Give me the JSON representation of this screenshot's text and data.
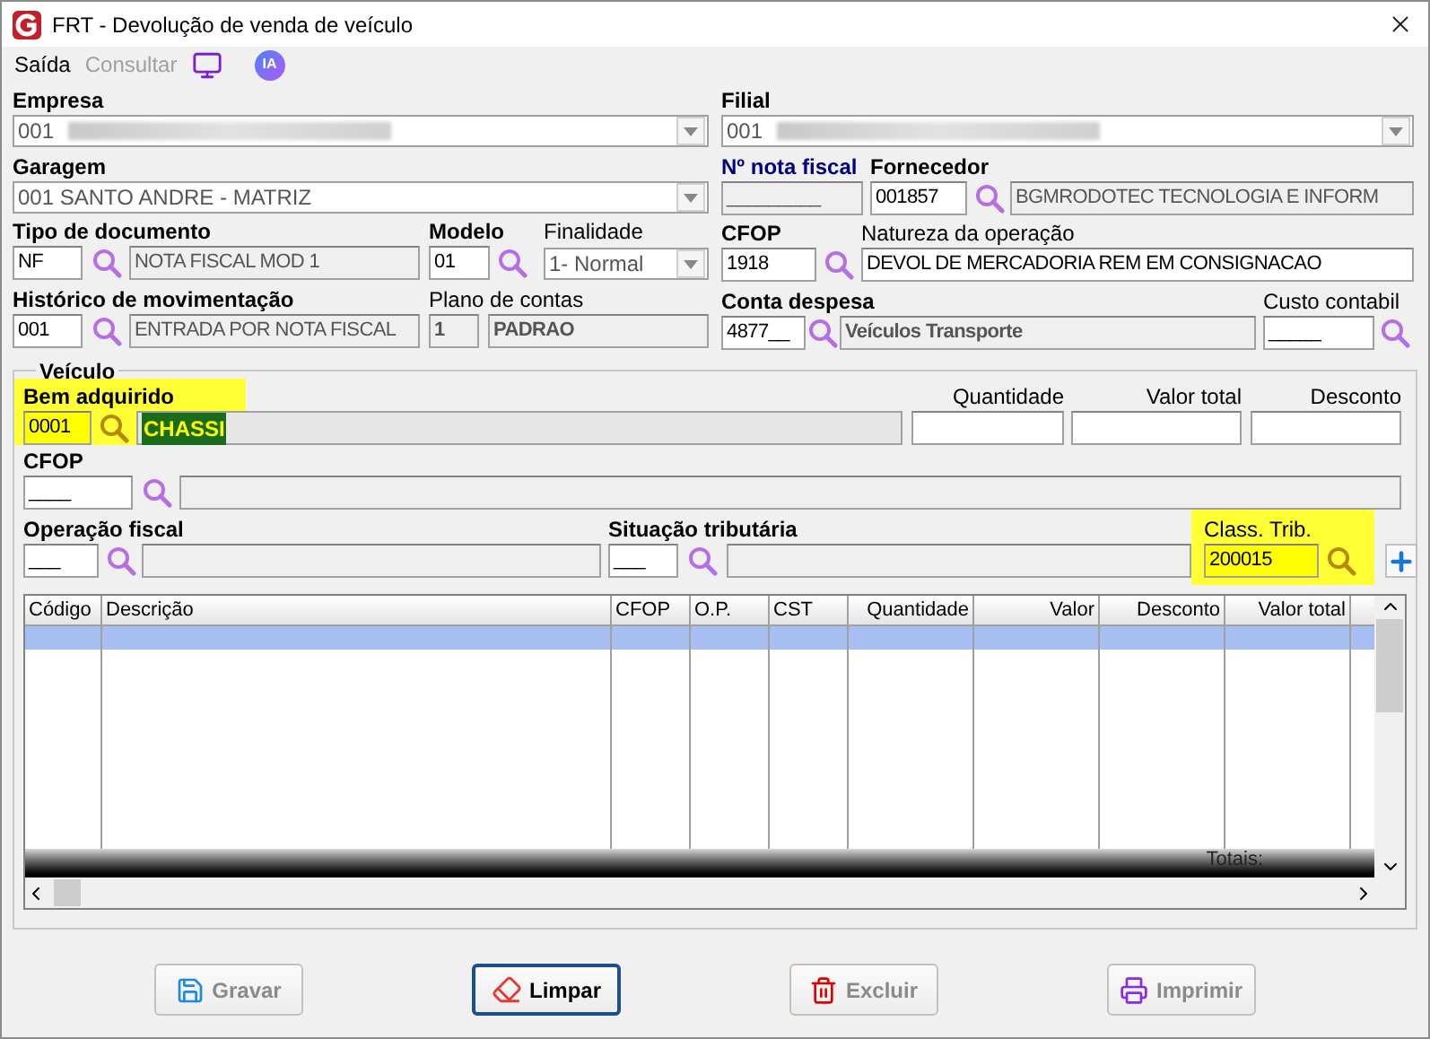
{
  "window": {
    "title": "FRT - Devolução de venda de veículo"
  },
  "menu": [
    {
      "label": "Saída",
      "disabled": false
    },
    {
      "label": "Consultar",
      "disabled": true
    }
  ],
  "ia_badge": "IA",
  "empresa": {
    "label": "Empresa",
    "value": "001"
  },
  "filial": {
    "label": "Filial",
    "value": "001"
  },
  "garagem": {
    "label": "Garagem",
    "value": "001 SANTO ANDRE - MATRIZ"
  },
  "nota_fiscal": {
    "label": "Nº nota fiscal",
    "value": "_________"
  },
  "fornecedor": {
    "label": "Fornecedor",
    "code": "001857",
    "name": "BGMRODOTEC TECNOLOGIA E INFORM"
  },
  "tipo_documento": {
    "label": "Tipo de documento",
    "code": "NF",
    "name": "NOTA FISCAL MOD 1"
  },
  "modelo": {
    "label": "Modelo",
    "code": "01"
  },
  "finalidade": {
    "label": "Finalidade",
    "value": "1- Normal"
  },
  "cfop": {
    "label": "CFOP",
    "code": "1918"
  },
  "natureza": {
    "label": "Natureza da operação",
    "value": "DEVOL DE MERCADORIA REM EM CONSIGNACAO"
  },
  "historico": {
    "label": "Histórico de movimentação",
    "code": "001",
    "name": "ENTRADA POR NOTA FISCAL"
  },
  "plano_contas": {
    "label": "Plano de contas",
    "code": "1",
    "name": "PADRAO"
  },
  "conta_despesa": {
    "label": "Conta despesa",
    "code": "4877__",
    "name": "Veículos Transporte"
  },
  "custo_contabil": {
    "label": "Custo contabil",
    "code": "_____"
  },
  "veiculo": {
    "legend": "Veículo",
    "bem": {
      "label": "Bem adquirido",
      "code": "0001",
      "name": "CHASSI",
      "highlighted": true
    },
    "quantidade": {
      "label": "Quantidade"
    },
    "valor_total": {
      "label": "Valor total"
    },
    "desconto": {
      "label": "Desconto"
    },
    "cfop": {
      "label": "CFOP",
      "code": "____"
    },
    "operacao": {
      "label": "Operação fiscal",
      "code": "___"
    },
    "situacao": {
      "label": "Situação tributária",
      "code": "___"
    },
    "class_trib": {
      "label": "Class. Trib.",
      "code": "200015",
      "highlighted": true
    }
  },
  "table": {
    "columns": [
      {
        "label": "Código"
      },
      {
        "label": "Descrição"
      },
      {
        "label": "CFOP"
      },
      {
        "label": "O.P."
      },
      {
        "label": "CST"
      },
      {
        "label": "Quantidade"
      },
      {
        "label": "Valor"
      },
      {
        "label": "Desconto"
      },
      {
        "label": "Valor total"
      }
    ],
    "rows": [
      {
        "selected": true
      }
    ],
    "totals_label": "Totais:"
  },
  "buttons": [
    {
      "label": "Gravar",
      "kind": "save",
      "disabled": true,
      "focused": false
    },
    {
      "label": "Limpar",
      "kind": "clear",
      "disabled": false,
      "focused": true
    },
    {
      "label": "Excluir",
      "kind": "delete",
      "disabled": true,
      "focused": false
    },
    {
      "label": "Imprimir",
      "kind": "print",
      "disabled": true,
      "focused": false
    }
  ]
}
